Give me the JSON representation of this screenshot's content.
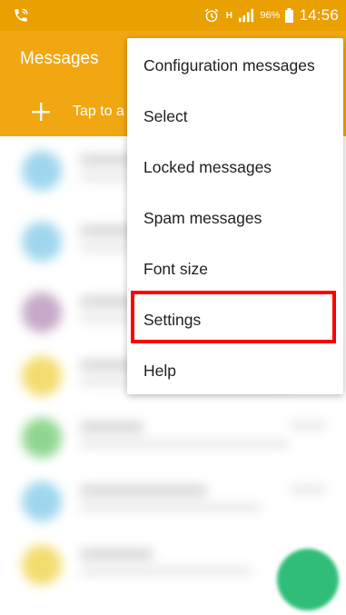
{
  "status_bar": {
    "battery_percent": "96%",
    "network_label": "H",
    "time": "14:56",
    "bar_color": "#e9a000"
  },
  "app_bar": {
    "title": "Messages",
    "compose_hint": "Tap to a",
    "color": "#f1a712"
  },
  "overflow_menu": {
    "items": [
      {
        "label": "Configuration messages"
      },
      {
        "label": "Select"
      },
      {
        "label": "Locked messages"
      },
      {
        "label": "Spam messages"
      },
      {
        "label": "Font size"
      },
      {
        "label": "Settings"
      },
      {
        "label": "Help"
      }
    ],
    "highlighted_item": "Settings",
    "highlight_color": "#ff0000"
  },
  "icons": {
    "status_call": "phone-wifi-call-icon",
    "status_alarm": "alarm-clock-icon",
    "status_signal": "cell-signal-icon",
    "status_battery": "battery-icon",
    "compose": "plus-icon",
    "fab": "compose-fab"
  },
  "conversation_avatar_colors": [
    "#9fd6ee",
    "#9fd6ee",
    "#c6a9c8",
    "#f3dc6e",
    "#8fd68f",
    "#9fd6ee",
    "#f3dc6e"
  ],
  "fab_color": "#2fbd79"
}
